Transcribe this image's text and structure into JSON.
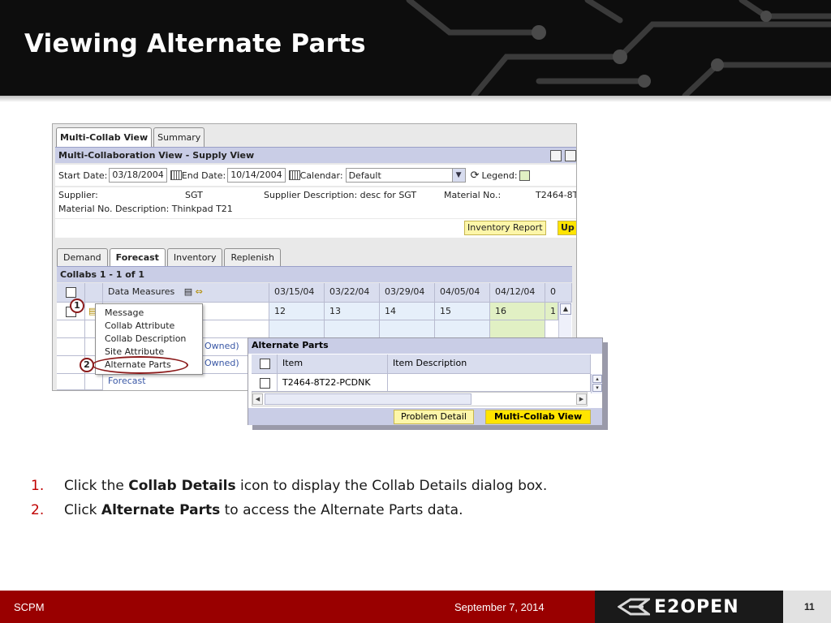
{
  "slide": {
    "title": "Viewing Alternate Parts",
    "footer_left": "SCPM",
    "footer_date": "September 7, 2014",
    "logo_text": "E2OPEN",
    "page_number": "11"
  },
  "app": {
    "top_tabs": [
      "Multi-Collab View",
      "Summary"
    ],
    "view_title": "Multi-Collaboration View - Supply View",
    "start_date_label": "Start Date:",
    "start_date_value": "03/18/2004",
    "end_date_label": "End Date:",
    "end_date_value": "10/14/2004",
    "calendar_label": "Calendar:",
    "calendar_value": "Default",
    "legend_label": "Legend:",
    "supplier_label": "Supplier:",
    "supplier_value": "SGT",
    "supplier_desc": "Supplier Description: desc for SGT",
    "material_no_label": "Material No.:",
    "material_no_value": "T2464-8T",
    "material_desc": "Material No. Description: Thinkpad T21",
    "inventory_report_button": "Inventory Report",
    "update_button": "Up",
    "mid_tabs": [
      "Demand",
      "Forecast",
      "Inventory",
      "Replenish"
    ],
    "collabs_title": "Collabs 1 - 1 of 1",
    "grid_header": {
      "data_measures": "Data Measures",
      "dates": [
        "03/15/04",
        "03/22/04",
        "03/29/04",
        "04/05/04",
        "04/12/04",
        "0"
      ]
    },
    "grid_row1": [
      "12",
      "13",
      "14",
      "15",
      "16",
      "1"
    ],
    "owned_1": "Owned)",
    "owned_2": "Owned)",
    "forecast_link": "Forecast"
  },
  "context_menu": {
    "items": [
      "Message",
      "Collab Attribute",
      "Collab Description",
      "Site Attribute",
      "Alternate Parts"
    ]
  },
  "badges": [
    "1",
    "2"
  ],
  "alternate_parts": {
    "title": "Alternate Parts",
    "col_item": "Item",
    "col_description": "Item Description",
    "row_item": "T2464-8T22-PCDNK",
    "row_description": "",
    "problem_detail_button": "Problem Detail",
    "multi_collab_button": "Multi-Collab View"
  },
  "instructions": [
    {
      "num": "1.",
      "pre": "Click the ",
      "bold": "Collab Details",
      "post": " icon to display the Collab Details dialog box."
    },
    {
      "num": "2.",
      "pre": "Click ",
      "bold": "Alternate Parts",
      "post": " to access the Alternate Parts data."
    }
  ]
}
